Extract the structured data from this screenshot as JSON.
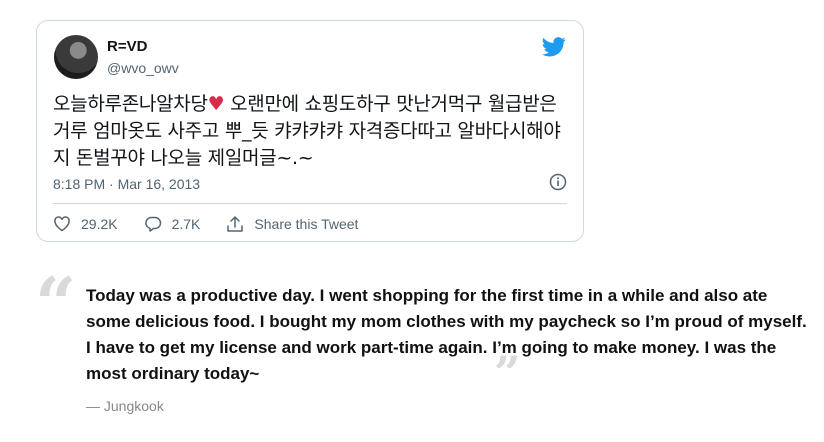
{
  "tweet": {
    "name": "R=VD",
    "handle": "@wvo_owv",
    "text_before_heart": "오늘하루존나알차당",
    "heart": "♥",
    "text_after_heart": " 오랜만에 쇼핑도하구 맛난거먹구 월급받은거루 엄마옷도 사주고 뿌_듯 캬캬캬캬 자격증다따고 알바다시해야지 돈벌꾸야 나오늘 제일머글~.~",
    "timestamp": "8:18 PM · Mar 16, 2013",
    "likes": "29.2K",
    "replies": "2.7K",
    "share_label": "Share this Tweet",
    "icons": [
      "twitter-bird-icon",
      "info-icon",
      "heart-icon",
      "reply-icon",
      "share-icon"
    ],
    "accent_color": "#1d9bf0"
  },
  "quote": {
    "text": "Today was a productive day. I went shopping for the first time in a while and also ate some delicious food. I bought my mom clothes with my paycheck so I’m proud of myself. I have to get my license and work part-time again. I’m going to make money. I was the most ordinary today~",
    "attribution": "— Jungkook"
  }
}
